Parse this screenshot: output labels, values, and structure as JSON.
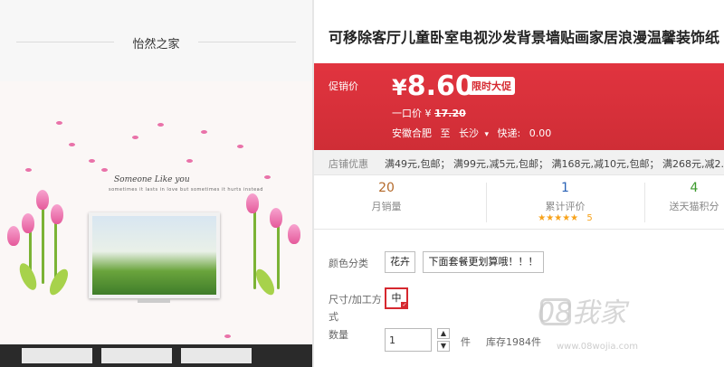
{
  "shop": {
    "name": "怡然之家"
  },
  "poster": {
    "caption": "Someone Like you",
    "small": "sometimes it lasts in love but sometimes it hurts instead"
  },
  "product": {
    "title": "可移除客厅儿童卧室电视沙发背景墙贴画家居浪漫温馨装饰纸"
  },
  "promo": {
    "label": "促销价",
    "price_currency": "¥",
    "price_value": "8.60",
    "badge": "限时大促",
    "original_label": "一口价",
    "original_currency": "¥",
    "original_value": "17.20",
    "ship_from": "安徽合肥",
    "ship_to_label": "至",
    "ship_to": "长沙",
    "ship_fee_label": "快递:",
    "ship_fee": "0.00"
  },
  "coupon": {
    "label": "店铺优惠",
    "text": "满49元,包邮； 满99元,减5元,包邮； 满168元,减10元,包邮； 满268元,减2..."
  },
  "stats": [
    {
      "number": "20",
      "label": "月销量"
    },
    {
      "number": "1",
      "label": "累计评价",
      "rating": "5"
    },
    {
      "number": "4",
      "label": "送天猫积分"
    }
  ],
  "options": {
    "color_label": "颜色分类",
    "color_values": [
      "花卉",
      "下面套餐更划算哦！！！"
    ],
    "size_label_1": "尺寸/加工方",
    "size_label_2": "式",
    "size_value": "中",
    "qty_label": "数量",
    "qty_value": "1",
    "qty_unit": "件",
    "stock": "库存1984件"
  },
  "watermark": {
    "text": "08我家",
    "sub": "www.08wojia.com"
  },
  "colors": {
    "promo_red": "#d6282f",
    "accent_blue": "#2a62b6",
    "stats_orange": "#b46a2b",
    "stats_green": "#3c9a2d"
  }
}
